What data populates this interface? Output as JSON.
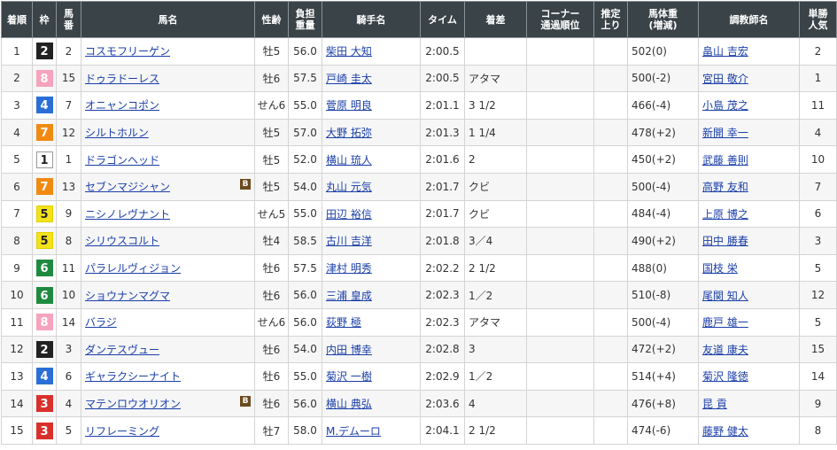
{
  "headers": [
    "着順",
    "枠",
    "馬番",
    "馬名",
    "性齢",
    "負担重量",
    "騎手名",
    "タイム",
    "着差",
    "コーナー通過順位",
    "推定上り",
    "馬体重(増減)",
    "調教師名",
    "単勝人気"
  ],
  "rows": [
    {
      "pos": "1",
      "waku": "2",
      "num": "2",
      "horse": "コスモフリーゲン",
      "blinker": "",
      "sex": "牡5",
      "weight": "56.0",
      "jockey": "柴田 大知",
      "time": "2:00.5",
      "margin": "",
      "corner": "",
      "last": "",
      "body": "502(0)",
      "trainer": "畠山 吉宏",
      "pop": "2"
    },
    {
      "pos": "2",
      "waku": "8",
      "num": "15",
      "horse": "ドゥラドーレス",
      "blinker": "",
      "sex": "牡6",
      "weight": "57.5",
      "jockey": "戸崎 圭太",
      "time": "2:00.5",
      "margin": "アタマ",
      "corner": "",
      "last": "",
      "body": "500(-2)",
      "trainer": "宮田 敬介",
      "pop": "1"
    },
    {
      "pos": "3",
      "waku": "4",
      "num": "7",
      "horse": "オニャンコポン",
      "blinker": "",
      "sex": "せん6",
      "weight": "55.0",
      "jockey": "菅原 明良",
      "time": "2:01.1",
      "margin": "3 1/2",
      "corner": "",
      "last": "",
      "body": "466(-4)",
      "trainer": "小島 茂之",
      "pop": "11"
    },
    {
      "pos": "4",
      "waku": "7",
      "num": "12",
      "horse": "シルトホルン",
      "blinker": "",
      "sex": "牡5",
      "weight": "57.0",
      "jockey": "大野 拓弥",
      "time": "2:01.3",
      "margin": "1 1/4",
      "corner": "",
      "last": "",
      "body": "478(+2)",
      "trainer": "新開 幸一",
      "pop": "4"
    },
    {
      "pos": "5",
      "waku": "1",
      "num": "1",
      "horse": "ドラゴンヘッド",
      "blinker": "",
      "sex": "牡5",
      "weight": "52.0",
      "jockey": "横山 琉人",
      "time": "2:01.6",
      "margin": "2",
      "corner": "",
      "last": "",
      "body": "450(+2)",
      "trainer": "武藤 善則",
      "pop": "10"
    },
    {
      "pos": "6",
      "waku": "7",
      "num": "13",
      "horse": "セブンマジシャン",
      "blinker": "B",
      "sex": "牡5",
      "weight": "54.0",
      "jockey": "丸山 元気",
      "time": "2:01.7",
      "margin": "クビ",
      "corner": "",
      "last": "",
      "body": "500(-4)",
      "trainer": "高野 友和",
      "pop": "7"
    },
    {
      "pos": "7",
      "waku": "5",
      "num": "9",
      "horse": "ニシノレヴナント",
      "blinker": "",
      "sex": "せん5",
      "weight": "55.0",
      "jockey": "田辺 裕信",
      "time": "2:01.7",
      "margin": "クビ",
      "corner": "",
      "last": "",
      "body": "484(-4)",
      "trainer": "上原 博之",
      "pop": "6"
    },
    {
      "pos": "8",
      "waku": "5",
      "num": "8",
      "horse": "シリウスコルト",
      "blinker": "",
      "sex": "牡4",
      "weight": "58.5",
      "jockey": "古川 吉洋",
      "time": "2:01.8",
      "margin": "3／4",
      "corner": "",
      "last": "",
      "body": "490(+2)",
      "trainer": "田中 勝春",
      "pop": "3"
    },
    {
      "pos": "9",
      "waku": "6",
      "num": "11",
      "horse": "パラレルヴィジョン",
      "blinker": "",
      "sex": "牡6",
      "weight": "57.5",
      "jockey": "津村 明秀",
      "time": "2:02.2",
      "margin": "2 1/2",
      "corner": "",
      "last": "",
      "body": "488(0)",
      "trainer": "国枝 栄",
      "pop": "5"
    },
    {
      "pos": "10",
      "waku": "6",
      "num": "10",
      "horse": "ショウナンマグマ",
      "blinker": "",
      "sex": "牡6",
      "weight": "56.0",
      "jockey": "三浦 皇成",
      "time": "2:02.3",
      "margin": "1／2",
      "corner": "",
      "last": "",
      "body": "510(-8)",
      "trainer": "尾関 知人",
      "pop": "12"
    },
    {
      "pos": "11",
      "waku": "8",
      "num": "14",
      "horse": "バラジ",
      "blinker": "",
      "sex": "せん6",
      "weight": "56.0",
      "jockey": "荻野 極",
      "time": "2:02.3",
      "margin": "アタマ",
      "corner": "",
      "last": "",
      "body": "500(-4)",
      "trainer": "鹿戸 雄一",
      "pop": "5"
    },
    {
      "pos": "12",
      "waku": "2",
      "num": "3",
      "horse": "ダンテスヴュー",
      "blinker": "",
      "sex": "牡6",
      "weight": "54.0",
      "jockey": "内田 博幸",
      "time": "2:02.8",
      "margin": "3",
      "corner": "",
      "last": "",
      "body": "472(+2)",
      "trainer": "友道 康夫",
      "pop": "15"
    },
    {
      "pos": "13",
      "waku": "4",
      "num": "6",
      "horse": "ギャラクシーナイト",
      "blinker": "",
      "sex": "牡6",
      "weight": "55.0",
      "jockey": "菊沢 一樹",
      "time": "2:02.9",
      "margin": "1／2",
      "corner": "",
      "last": "",
      "body": "514(+4)",
      "trainer": "菊沢 隆徳",
      "pop": "14"
    },
    {
      "pos": "14",
      "waku": "3",
      "num": "4",
      "horse": "マテンロウオリオン",
      "blinker": "B",
      "sex": "牡6",
      "weight": "56.0",
      "jockey": "横山 典弘",
      "time": "2:03.6",
      "margin": "4",
      "corner": "",
      "last": "",
      "body": "476(+8)",
      "trainer": "昆 貢",
      "pop": "9"
    },
    {
      "pos": "15",
      "waku": "3",
      "num": "5",
      "horse": "リフレーミング",
      "blinker": "",
      "sex": "牡7",
      "weight": "58.0",
      "jockey": "M.デムーロ",
      "time": "2:04.1",
      "margin": "2 1/2",
      "corner": "",
      "last": "",
      "body": "474(-6)",
      "trainer": "藤野 健太",
      "pop": "8"
    }
  ]
}
